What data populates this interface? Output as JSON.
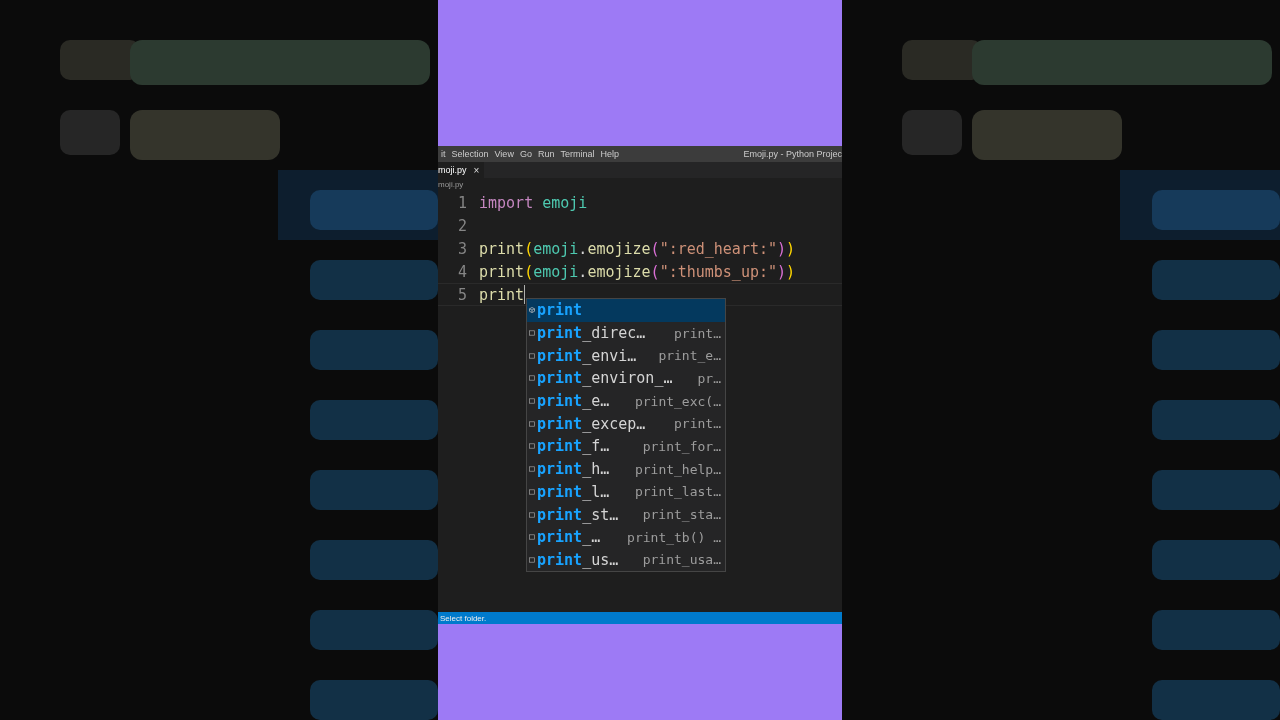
{
  "menu_bar": {
    "items": [
      "it",
      "Selection",
      "View",
      "Go",
      "Run",
      "Terminal",
      "Help"
    ],
    "title": "Emoji.py - Python Projec"
  },
  "tabs": [
    {
      "label": "moji.py",
      "selected": true,
      "close": "×"
    }
  ],
  "breadcrumb": "moji.py",
  "editor": {
    "lines": [
      {
        "number": "1",
        "tokens": [
          {
            "text": "import",
            "kind": "keyword"
          },
          {
            "text": " emoji",
            "kind": "module"
          }
        ]
      },
      {
        "number": "2"
      },
      {
        "number": "3",
        "tokens": [
          {
            "text": "print",
            "kind": "function"
          },
          {
            "text": "(",
            "kind": "paren1"
          },
          {
            "text": "emoji",
            "kind": "module"
          },
          {
            "text": ".",
            "kind": "plain"
          },
          {
            "text": "emojize",
            "kind": "function"
          },
          {
            "text": "(",
            "kind": "paren2"
          },
          {
            "text": "\":red_heart:\"",
            "kind": "string"
          },
          {
            "text": ")",
            "kind": "paren2"
          },
          {
            "text": ")",
            "kind": "paren1"
          }
        ]
      },
      {
        "number": "4",
        "tokens": [
          {
            "text": "print",
            "kind": "function"
          },
          {
            "text": "(",
            "kind": "paren1"
          },
          {
            "text": "emoji",
            "kind": "module"
          },
          {
            "text": ".",
            "kind": "plain"
          },
          {
            "text": "emojize",
            "kind": "function"
          },
          {
            "text": "(",
            "kind": "paren2"
          },
          {
            "text": "\":thumbs_up:\"",
            "kind": "string"
          },
          {
            "text": ")",
            "kind": "paren2"
          },
          {
            "text": ")",
            "kind": "paren1"
          }
        ]
      },
      {
        "number": "5",
        "tokens": [
          {
            "text": "print",
            "kind": "function"
          }
        ],
        "current": true
      }
    ]
  },
  "suggestions": [
    {
      "label": "**print**",
      "kind": "method",
      "selected": true
    },
    {
      "label": "**print**_direc…",
      "detail": "print…",
      "kind": "variable",
      "selected": false
    },
    {
      "label": "**print**_envi…",
      "detail": "print_e…",
      "kind": "variable",
      "selected": false
    },
    {
      "label": "**print**_environ_…",
      "detail": "pr…",
      "kind": "variable",
      "selected": false
    },
    {
      "label": "**print**_e…",
      "detail": "print_exc(…",
      "kind": "variable",
      "selected": false
    },
    {
      "label": "**print**_excep…",
      "detail": "print…",
      "kind": "variable",
      "selected": false
    },
    {
      "label": "**print**_f…",
      "detail": "print_for…",
      "kind": "variable",
      "selected": false
    },
    {
      "label": "**print**_h…",
      "detail": "print_help…",
      "kind": "variable",
      "selected": false
    },
    {
      "label": "**print**_l…",
      "detail": "print_last…",
      "kind": "variable",
      "selected": false
    },
    {
      "label": "**print**_st…",
      "detail": "print_sta…",
      "kind": "variable",
      "selected": false
    },
    {
      "label": "**print**_…",
      "detail": "print_tb() …",
      "kind": "variable",
      "selected": false
    },
    {
      "label": "**print**_us…",
      "detail": "print_usa…",
      "kind": "variable",
      "selected": false
    }
  ],
  "status_bar": "Select folder."
}
